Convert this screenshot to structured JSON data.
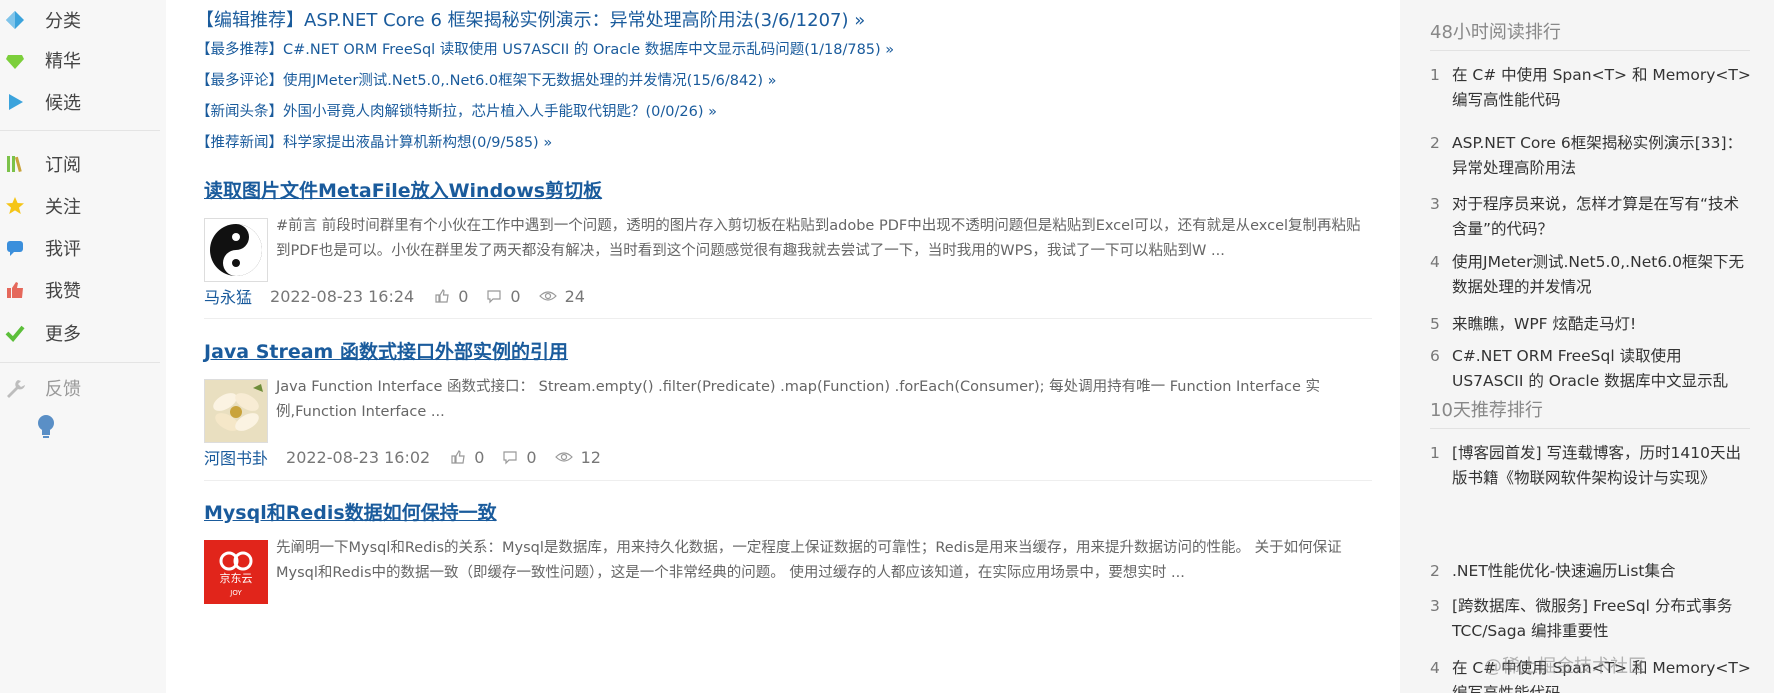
{
  "nav": {
    "items": [
      {
        "label": "分类",
        "icon": "category-diamond-icon"
      },
      {
        "label": "精华",
        "icon": "gem-icon"
      },
      {
        "label": "候选",
        "icon": "play-icon"
      },
      {
        "label": "订阅",
        "icon": "books-icon"
      },
      {
        "label": "关注",
        "icon": "star-icon"
      },
      {
        "label": "我评",
        "icon": "comment-icon"
      },
      {
        "label": "我赞",
        "icon": "thumbs-up-icon"
      },
      {
        "label": "更多",
        "icon": "check-icon"
      },
      {
        "label": "反馈",
        "icon": "wrench-icon"
      }
    ],
    "colors": {
      "cat": "#3ba3dc",
      "gem": "#7ccf3b",
      "play": "#3ba3dc",
      "books": "#7cc24a",
      "star": "#f5c518",
      "comment": "#3b8fdc",
      "thumb": "#e5685b",
      "check": "#5cbf3a"
    }
  },
  "recommendations": {
    "editor": "【编辑推荐】ASP.NET Core 6 框架揭秘实例演示：异常处理高阶用法(3/6/1207) »",
    "most_recommended": "【最多推荐】C#.NET ORM FreeSql 读取使用 US7ASCII 的 Oracle 数据库中文显示乱码问题(1/18/785) »",
    "most_commented": "【最多评论】使用JMeter测试.Net5.0,.Net6.0框架下无数据处理的并发情况(15/6/842) »",
    "headline": "【新闻头条】外国小哥竟人肉解锁特斯拉，芯片植入人手能取代钥匙？(0/0/26) »",
    "news": "【推荐新闻】科学家提出液晶计算机新构想(0/9/585) »"
  },
  "posts": [
    {
      "title": "读取图片文件MetaFile放入Windows剪切板",
      "summary": "#前言 前段时间群里有个小伙在工作中遇到一个问题，透明的图片存入剪切板在粘贴到adobe PDF中出现不透明问题但是粘贴到Excel可以，还有就是从excel复制再粘贴到PDF也是可以。小伙在群里发了两天都没有解决，当时看到这个问题感觉很有趣我就去尝试了一下，当时我用的WPS，我试了一下可以粘贴到W ...",
      "author": "马永猛",
      "date": "2022-08-23 16:24",
      "likes": "0",
      "comments": "0",
      "views": "24",
      "avatar": "yin-yang-avatar"
    },
    {
      "title": "Java Stream 函数式接口外部实例的引用",
      "summary": "Java Function Interface 函数式接口： Stream.empty() .filter(Predicate) .map(Function) .forEach(Consumer); 每处调用持有唯一 Function Interface 实例,Function Interface ...",
      "author": "河图书卦",
      "date": "2022-08-23 16:02",
      "likes": "0",
      "comments": "0",
      "views": "12",
      "avatar": "flower-avatar"
    },
    {
      "title": "Mysql和Redis数据如何保持一致",
      "summary": "先阐明一下Mysql和Redis的关系：Mysql是数据库，用来持久化数据，一定程度上保证数据的可靠性；Redis是用来当缓存，用来提升数据访问的性能。 关于如何保证Mysql和Redis中的数据一致（即缓存一致性问题），这是一个非常经典的问题。 使用过缓存的人都应该知道，在实际应用场景中，要想实时 ...",
      "avatar_text": "京东云",
      "avatar_sub": "JOY",
      "avatar": "jdcloud-logo"
    }
  ],
  "sidebar": {
    "hot48": {
      "heading": "48小时阅读排行",
      "items": [
        {
          "num": "1",
          "text": "在 C# 中使用 Span<T> 和 Memory<T> 编写高性能代码"
        },
        {
          "num": "2",
          "text": "ASP.NET Core 6框架揭秘实例演示[33]：异常处理高阶用法"
        },
        {
          "num": "3",
          "text": "对于程序员来说，怎样才算是在写有“技术含量”的代码？"
        },
        {
          "num": "4",
          "text": "使用JMeter测试.Net5.0,.Net6.0框架下无数据处理的并发情况"
        },
        {
          "num": "5",
          "text": "来瞧瞧，WPF 炫酷走马灯!"
        },
        {
          "num": "6",
          "text": "C#.NET ORM FreeSql 读取使用 US7ASCII 的 Oracle 数据库中文显示乱"
        }
      ]
    },
    "rec10": {
      "heading": "10天推荐排行",
      "items": [
        {
          "num": "1",
          "text": "[博客园首发] 写连载博客，历时1410天出版书籍《物联网软件架构设计与实现》"
        },
        {
          "num": "2",
          "text": ".NET性能优化-快速遍历List集合"
        },
        {
          "num": "3",
          "text": "[跨数据库、微服务] FreeSql 分布式事务 TCC/Saga 编排重要性"
        },
        {
          "num": "4",
          "text": "在 C# 中使用 Span<T> 和 Memory<T> 编写高性能代码"
        }
      ]
    }
  },
  "watermark": "@稀土掘金技术社区"
}
